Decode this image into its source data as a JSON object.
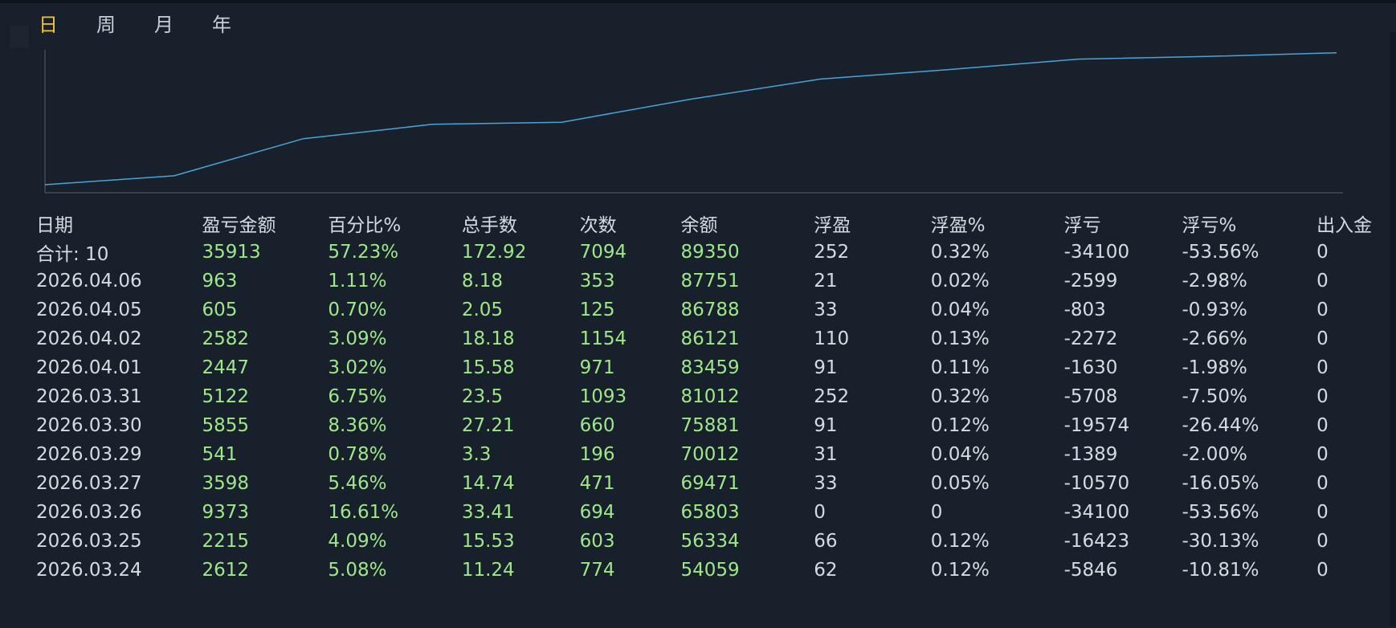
{
  "tabs": [
    {
      "label": "日",
      "active": true
    },
    {
      "label": "周",
      "active": false
    },
    {
      "label": "月",
      "active": false
    },
    {
      "label": "年",
      "active": false
    }
  ],
  "colors": {
    "background": "#18202b",
    "active_tab": "#f3c334",
    "value_green": "#9ee88a",
    "line": "#4aa3d8",
    "axis": "#56606c"
  },
  "chart_data": {
    "type": "line",
    "x": [
      "2026.03.24",
      "2026.03.25",
      "2026.03.26",
      "2026.03.27",
      "2026.03.29",
      "2026.03.30",
      "2026.03.31",
      "2026.04.01",
      "2026.04.02",
      "2026.04.05",
      "2026.04.06"
    ],
    "series": [
      {
        "values": [
          54059,
          56334,
          65803,
          69471,
          70012,
          75881,
          81012,
          83459,
          86121,
          86788,
          87751
        ]
      }
    ],
    "ylim": [
      52000,
      88500
    ],
    "grid": false
  },
  "table": {
    "headers": [
      "日期",
      "盈亏金额",
      "百分比%",
      "总手数",
      "次数",
      "余额",
      "浮盈",
      "浮盈%",
      "浮亏",
      "浮亏%",
      "出入金"
    ],
    "total": [
      "合计: 10",
      "35913",
      "57.23%",
      "172.92",
      "7094",
      "89350",
      "252",
      "0.32%",
      "-34100",
      "-53.56%",
      "0"
    ],
    "rows": [
      [
        "2026.04.06",
        "963",
        "1.11%",
        "8.18",
        "353",
        "87751",
        "21",
        "0.02%",
        "-2599",
        "-2.98%",
        "0"
      ],
      [
        "2026.04.05",
        "605",
        "0.70%",
        "2.05",
        "125",
        "86788",
        "33",
        "0.04%",
        "-803",
        "-0.93%",
        "0"
      ],
      [
        "2026.04.02",
        "2582",
        "3.09%",
        "18.18",
        "1154",
        "86121",
        "110",
        "0.13%",
        "-2272",
        "-2.66%",
        "0"
      ],
      [
        "2026.04.01",
        "2447",
        "3.02%",
        "15.58",
        "971",
        "83459",
        "91",
        "0.11%",
        "-1630",
        "-1.98%",
        "0"
      ],
      [
        "2026.03.31",
        "5122",
        "6.75%",
        "23.5",
        "1093",
        "81012",
        "252",
        "0.32%",
        "-5708",
        "-7.50%",
        "0"
      ],
      [
        "2026.03.30",
        "5855",
        "8.36%",
        "27.21",
        "660",
        "75881",
        "91",
        "0.12%",
        "-19574",
        "-26.44%",
        "0"
      ],
      [
        "2026.03.29",
        "541",
        "0.78%",
        "3.3",
        "196",
        "70012",
        "31",
        "0.04%",
        "-1389",
        "-2.00%",
        "0"
      ],
      [
        "2026.03.27",
        "3598",
        "5.46%",
        "14.74",
        "471",
        "69471",
        "33",
        "0.05%",
        "-10570",
        "-16.05%",
        "0"
      ],
      [
        "2026.03.26",
        "9373",
        "16.61%",
        "33.41",
        "694",
        "65803",
        "0",
        "0",
        "-34100",
        "-53.56%",
        "0"
      ],
      [
        "2026.03.25",
        "2215",
        "4.09%",
        "15.53",
        "603",
        "56334",
        "66",
        "0.12%",
        "-16423",
        "-30.13%",
        "0"
      ],
      [
        "2026.03.24",
        "2612",
        "5.08%",
        "11.24",
        "774",
        "54059",
        "62",
        "0.12%",
        "-5846",
        "-10.81%",
        "0"
      ]
    ]
  }
}
